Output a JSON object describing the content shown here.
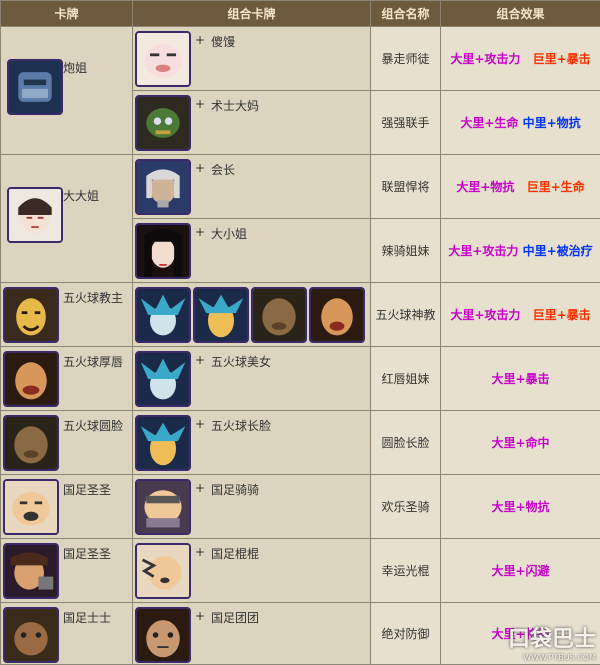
{
  "header": {
    "col1": "卡牌",
    "col2": "组合卡牌",
    "col3": "组合名称",
    "col4": "组合效果"
  },
  "plus": "+",
  "rows": [
    {
      "card": "炮姐",
      "combo": "傻馒",
      "name": "暴走师徒",
      "effect": [
        {
          "text": "大里+攻击力",
          "c": "e1"
        },
        {
          "text": "巨里+暴击",
          "c": "e2"
        }
      ]
    },
    {
      "card": "",
      "combo": "术士大妈",
      "name": "强强联手",
      "effect": [
        {
          "text": "大里+生命",
          "c": "e1"
        },
        {
          "text": "中里+物抗",
          "c": "e3"
        }
      ]
    },
    {
      "card": "大大姐",
      "combo": "会长",
      "name": "联盟悍将",
      "effect": [
        {
          "text": "大里+物抗",
          "c": "e1"
        },
        {
          "text": "巨里+生命",
          "c": "e2"
        }
      ]
    },
    {
      "card": "",
      "combo": "大小姐",
      "name": "辣骑姐妹",
      "effect": [
        {
          "text": "大里+攻击力",
          "c": "e1"
        },
        {
          "text": "中里+被治疗",
          "c": "e3"
        }
      ]
    },
    {
      "card": "五火球教主",
      "combo": "",
      "name": "五火球神教",
      "effect": [
        {
          "text": "大里+攻击力",
          "c": "e1"
        },
        {
          "text": "巨里+暴击",
          "c": "e2"
        }
      ]
    },
    {
      "card": "五火球厚唇",
      "combo": "五火球美女",
      "name": "红唇姐妹",
      "effect": [
        {
          "text": "大里+暴击",
          "c": "e1"
        }
      ]
    },
    {
      "card": "五火球圆脸",
      "combo": "五火球长脸",
      "name": "圆脸长脸",
      "effect": [
        {
          "text": "大里+命中",
          "c": "e1"
        }
      ]
    },
    {
      "card": "国足圣圣",
      "combo": "国足骑骑",
      "name": "欢乐圣骑",
      "effect": [
        {
          "text": "大里+物抗",
          "c": "e1"
        }
      ]
    },
    {
      "card": "国足圣圣",
      "combo": "国足棍棍",
      "name": "幸运光棍",
      "effect": [
        {
          "text": "大里+闪避",
          "c": "e1"
        }
      ]
    },
    {
      "card": "国足士士",
      "combo": "国足团团",
      "name": "绝对防御",
      "effect": [
        {
          "text": "大里+格挡",
          "c": "e1"
        }
      ]
    }
  ],
  "watermark": {
    "brand": "口袋巴士",
    "url": "WWW.PTBUS.COM"
  }
}
